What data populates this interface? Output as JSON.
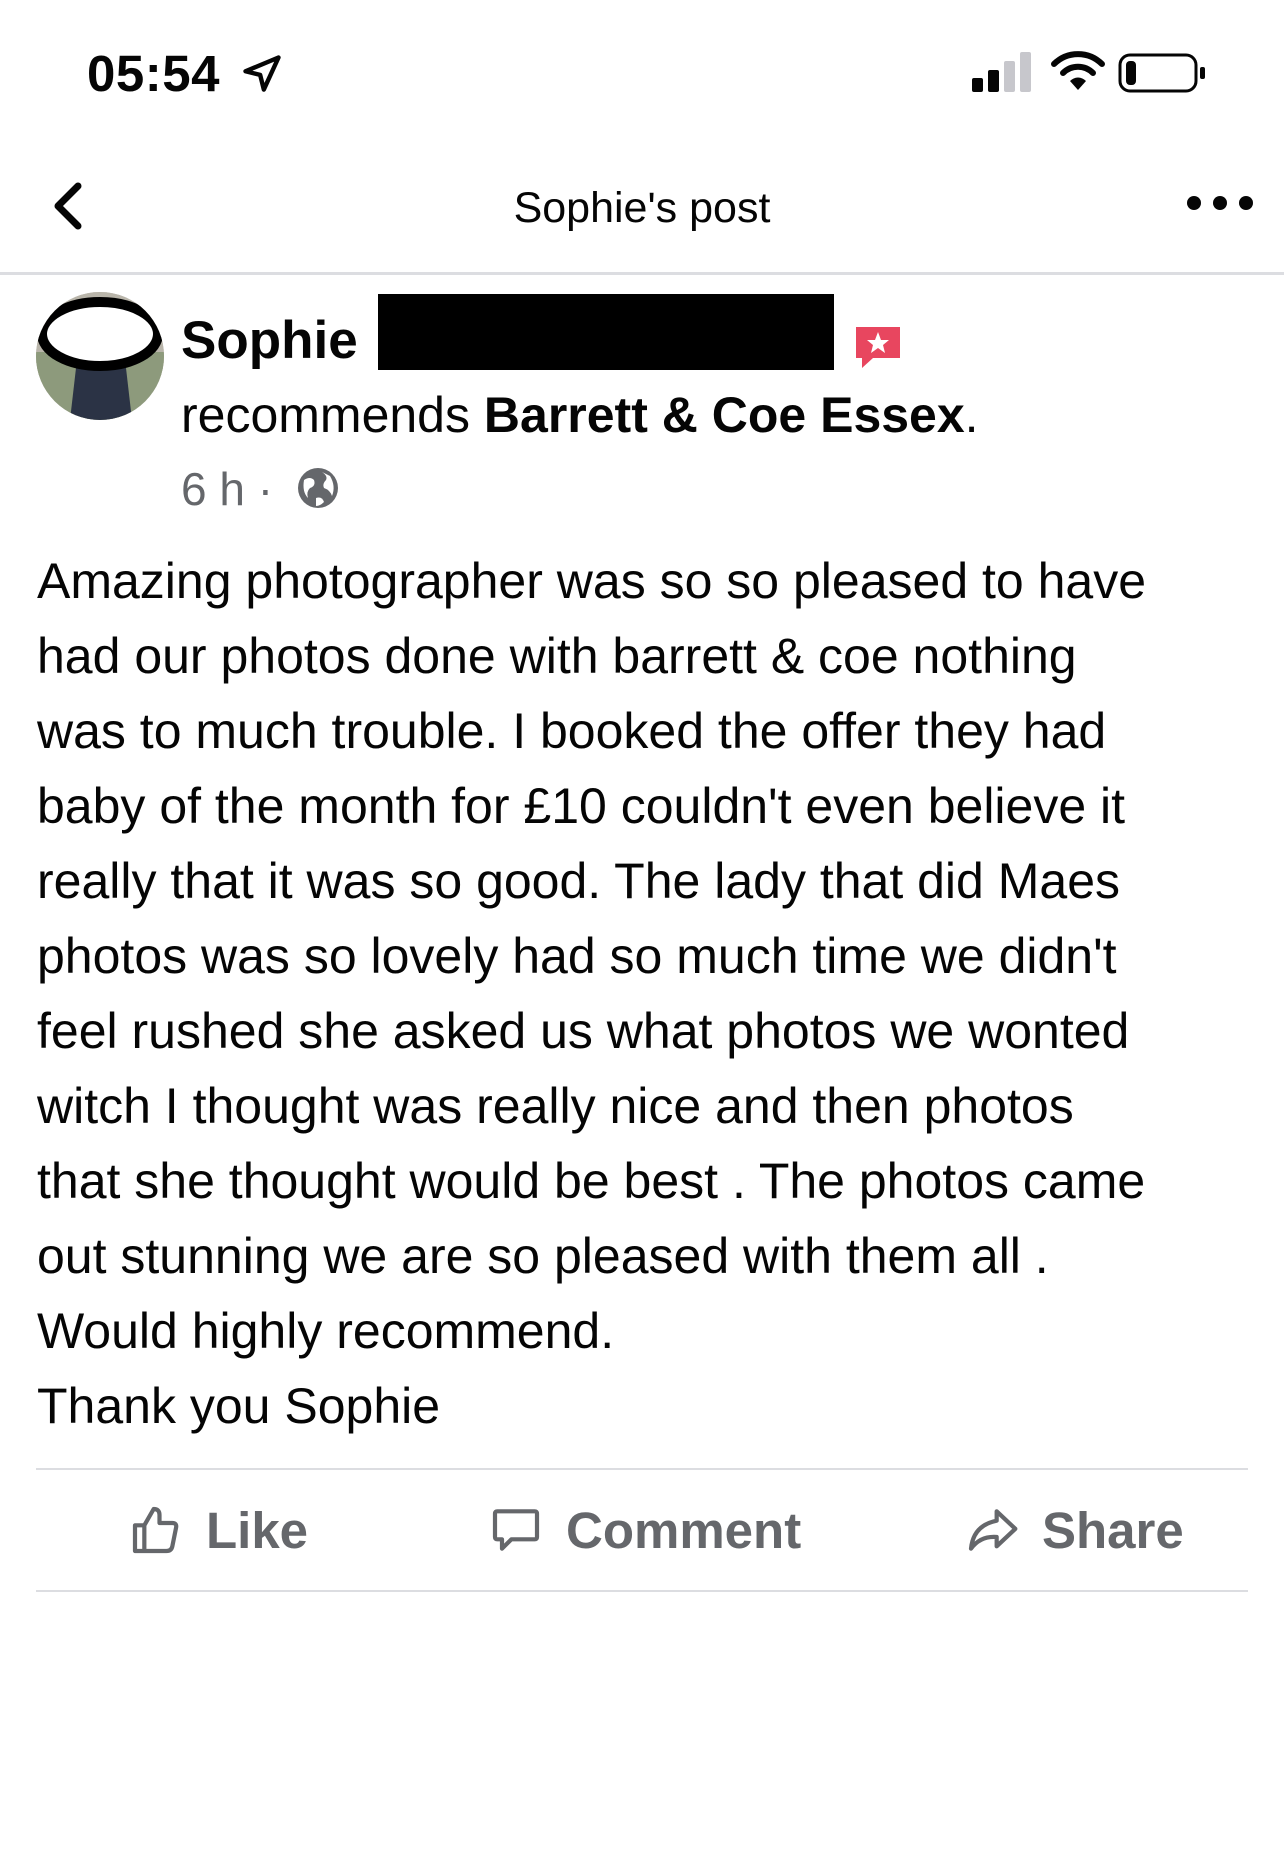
{
  "status_bar": {
    "time": "05:54",
    "signal_bars": 2,
    "battery_level": 0.15
  },
  "nav": {
    "title": "Sophie's post"
  },
  "post": {
    "author": "Sophie",
    "verb": "recommends",
    "business": "Barrett & Coe Essex",
    "period": ".",
    "time_ago": "6 h ·",
    "body": "Amazing photographer was so so pleased to have\nhad our photos done with barrett & coe nothing\nwas to much trouble. I booked the offer they had\nbaby of the month for £10 couldn't even believe it\nreally that it was so good. The lady that did Maes\nphotos was so lovely had so much time we didn't\nfeel rushed she asked us what photos we wonted\nwitch I thought was really nice and then photos\nthat she thought would be best . The photos came\nout stunning we are so pleased with them all .\nWould highly recommend.\nThank you Sophie"
  },
  "actions": {
    "like": "Like",
    "comment": "Comment",
    "share": "Share"
  },
  "icons": [
    "location-arrow-icon",
    "signal-icon",
    "wifi-icon",
    "battery-icon",
    "back-chevron-icon",
    "more-dots-icon",
    "recommendation-badge-icon",
    "globe-icon",
    "thumbs-up-icon",
    "comment-bubble-icon",
    "share-arrow-icon"
  ],
  "colors": {
    "secondary_text": "#65676b",
    "badge": "#e8465f",
    "divider": "#dcdde1"
  }
}
